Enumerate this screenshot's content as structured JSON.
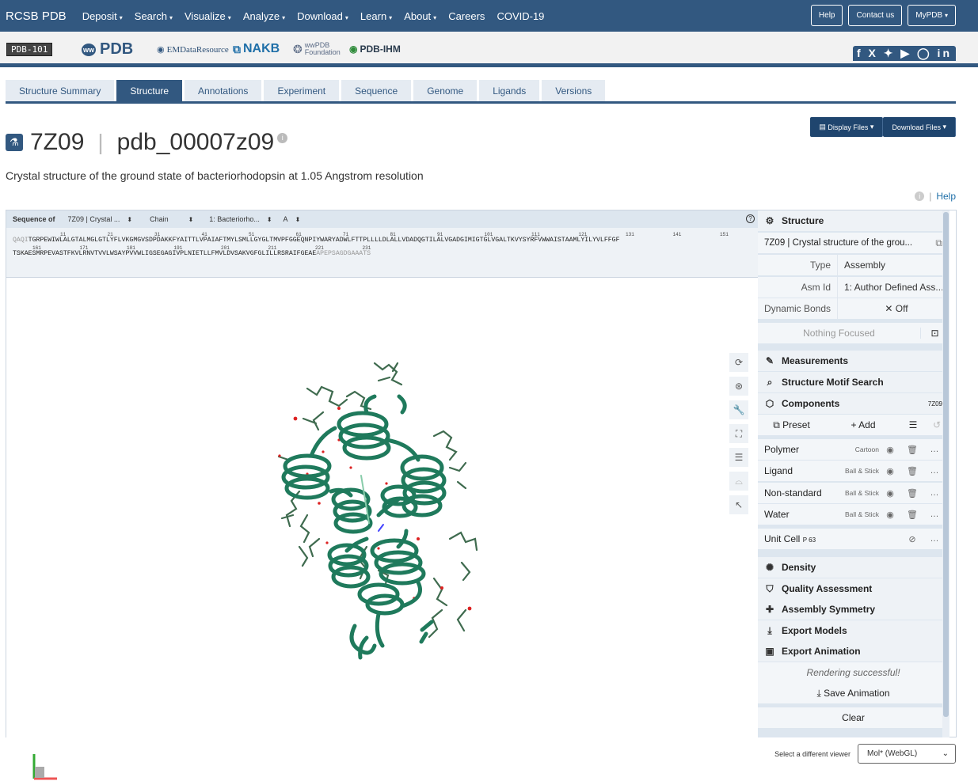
{
  "nav": {
    "brand": "RCSB PDB",
    "items": [
      "Deposit",
      "Search",
      "Visualize",
      "Analyze",
      "Download",
      "Learn",
      "About",
      "Careers",
      "COVID-19"
    ],
    "buttons": [
      "Help",
      "Contact us",
      "MyPDB"
    ]
  },
  "partners": {
    "pdb101": "PDB-101",
    "wwpdb": "PDB",
    "emdr": "EMDataResource",
    "nakb": "NAKB",
    "wwpdbf": "wwPDB Foundation",
    "ihm": "PDB-IHM",
    "social": "f X ✦ ▶ ◯ in"
  },
  "tabs": [
    "Structure Summary",
    "Structure",
    "Annotations",
    "Experiment",
    "Sequence",
    "Genome",
    "Ligands",
    "Versions"
  ],
  "active_tab": "Structure",
  "files": {
    "display": "Display Files",
    "download": "Download Files"
  },
  "entry": {
    "id": "7Z09",
    "ext_id": "pdb_00007z09",
    "title": "Crystal structure of the ground state of bacteriorhodopsin at 1.05 Angstrom resolution"
  },
  "help_link": "Help",
  "sequence": {
    "label": "Sequence of",
    "selects": [
      "7Z09 | Crystal ...",
      "Chain",
      "1: Bacteriorho...",
      "A"
    ],
    "line1_dim": "QAQI",
    "line1": "TGRPEWIWLALGTALMGLGTLYFLVKGMGVSDPDAKKFYAITTLVPAIAFTMYLSMLLGYGLTMVPFGGEQNPIYWARYADWLFTTPLLLLDLALLVDADQGTILALVGADGIMIGTGLVGALTKVYSYRFVWWAISTAAMLYILYVLFFGF",
    "line2": "TSKAESMRPEVASTFKVLRNVTVVLWSAYPVVWLIGSEGAGIVPLNIETLLFMVLDVSAKVGFGLILLRSRAIFGEAE",
    "line2_dim": "APEPSAGDGAAATS",
    "numbers1": [
      "11",
      "21",
      "31",
      "41",
      "51",
      "61",
      "71",
      "81",
      "91",
      "101",
      "111",
      "121",
      "131",
      "141",
      "151"
    ],
    "numbers2": [
      "161",
      "171",
      "181",
      "191",
      "201",
      "211",
      "221",
      "231"
    ]
  },
  "panel": {
    "structure_label": "Structure",
    "structure_name": "7Z09 | Crystal structure of the grou...",
    "type_label": "Type",
    "type_value": "Assembly",
    "asm_label": "Asm Id",
    "asm_value": "1: Author Defined Ass...",
    "bonds_label": "Dynamic Bonds",
    "bonds_value": "✕  Off",
    "focus": "Nothing Focused",
    "measurements": "Measurements",
    "motif": "Structure Motif Search",
    "components": "Components",
    "components_id": "7Z09",
    "preset": "Preset",
    "add": "Add",
    "polymer": "Polymer",
    "polymer_type": "Cartoon",
    "ligand": "Ligand",
    "ligand_type": "Ball & Stick",
    "nonstd": "Non-standard",
    "nonstd_type": "Ball & Stick",
    "water": "Water",
    "water_type": "Ball & Stick",
    "unitcell": "Unit Cell",
    "unitcell_sg": "P 63",
    "density": "Density",
    "quality": "Quality Assessment",
    "symmetry": "Assembly Symmetry",
    "export_models": "Export Models",
    "export_anim": "Export Animation",
    "rendering": "Rendering successful!",
    "save_anim": "Save Animation",
    "clear": "Clear"
  },
  "footer": {
    "label": "Select a different viewer",
    "viewer": "Mol* (WebGL)"
  },
  "colors": {
    "brand": "#325880",
    "cartoon": "#1f7a5c",
    "stick": "#2f5f3f"
  }
}
